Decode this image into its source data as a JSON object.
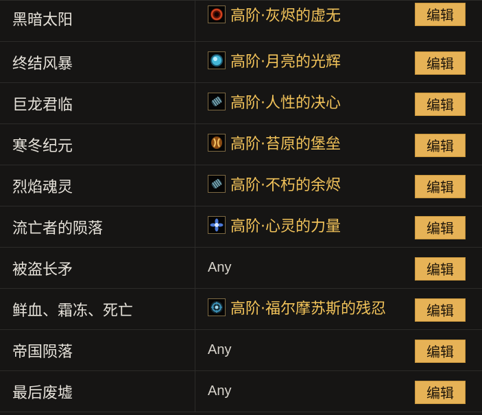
{
  "edit_label": "编辑",
  "rows": [
    {
      "name": "黑暗太阳",
      "value": "高阶·灰烬的虚无",
      "icon": "ash-void-gem-icon",
      "color": "#c23a1e"
    },
    {
      "name": "终结风暴",
      "value": "高阶·月亮的光辉",
      "icon": "moon-radiance-gem-icon",
      "color": "#37a9c9"
    },
    {
      "name": "巨龙君临",
      "value": "高阶·人性的决心",
      "icon": "human-resolve-gem-icon",
      "color": "#4f8a9a"
    },
    {
      "name": "寒冬纪元",
      "value": "高阶·苔原的堡垒",
      "icon": "tundra-bastion-gem-icon",
      "color": "#e0a040"
    },
    {
      "name": "烈焰魂灵",
      "value": "高阶·不朽的余烬",
      "icon": "immortal-ember-gem-icon",
      "color": "#4f8a9a"
    },
    {
      "name": "流亡者的陨落",
      "value": "高阶·心灵的力量",
      "icon": "mind-power-gem-icon",
      "color": "#4a78d8"
    },
    {
      "name": "被盗长矛",
      "value": "Any",
      "icon": null,
      "color": null
    },
    {
      "name": "鲜血、霜冻、死亡",
      "value": "高阶·福尔摩苏斯的残忍",
      "icon": "formosus-cruelty-gem-icon",
      "color": "#3a8fb5"
    },
    {
      "name": "帝国陨落",
      "value": "Any",
      "icon": null,
      "color": null
    },
    {
      "name": "最后废墟",
      "value": "Any",
      "icon": null,
      "color": null
    }
  ]
}
